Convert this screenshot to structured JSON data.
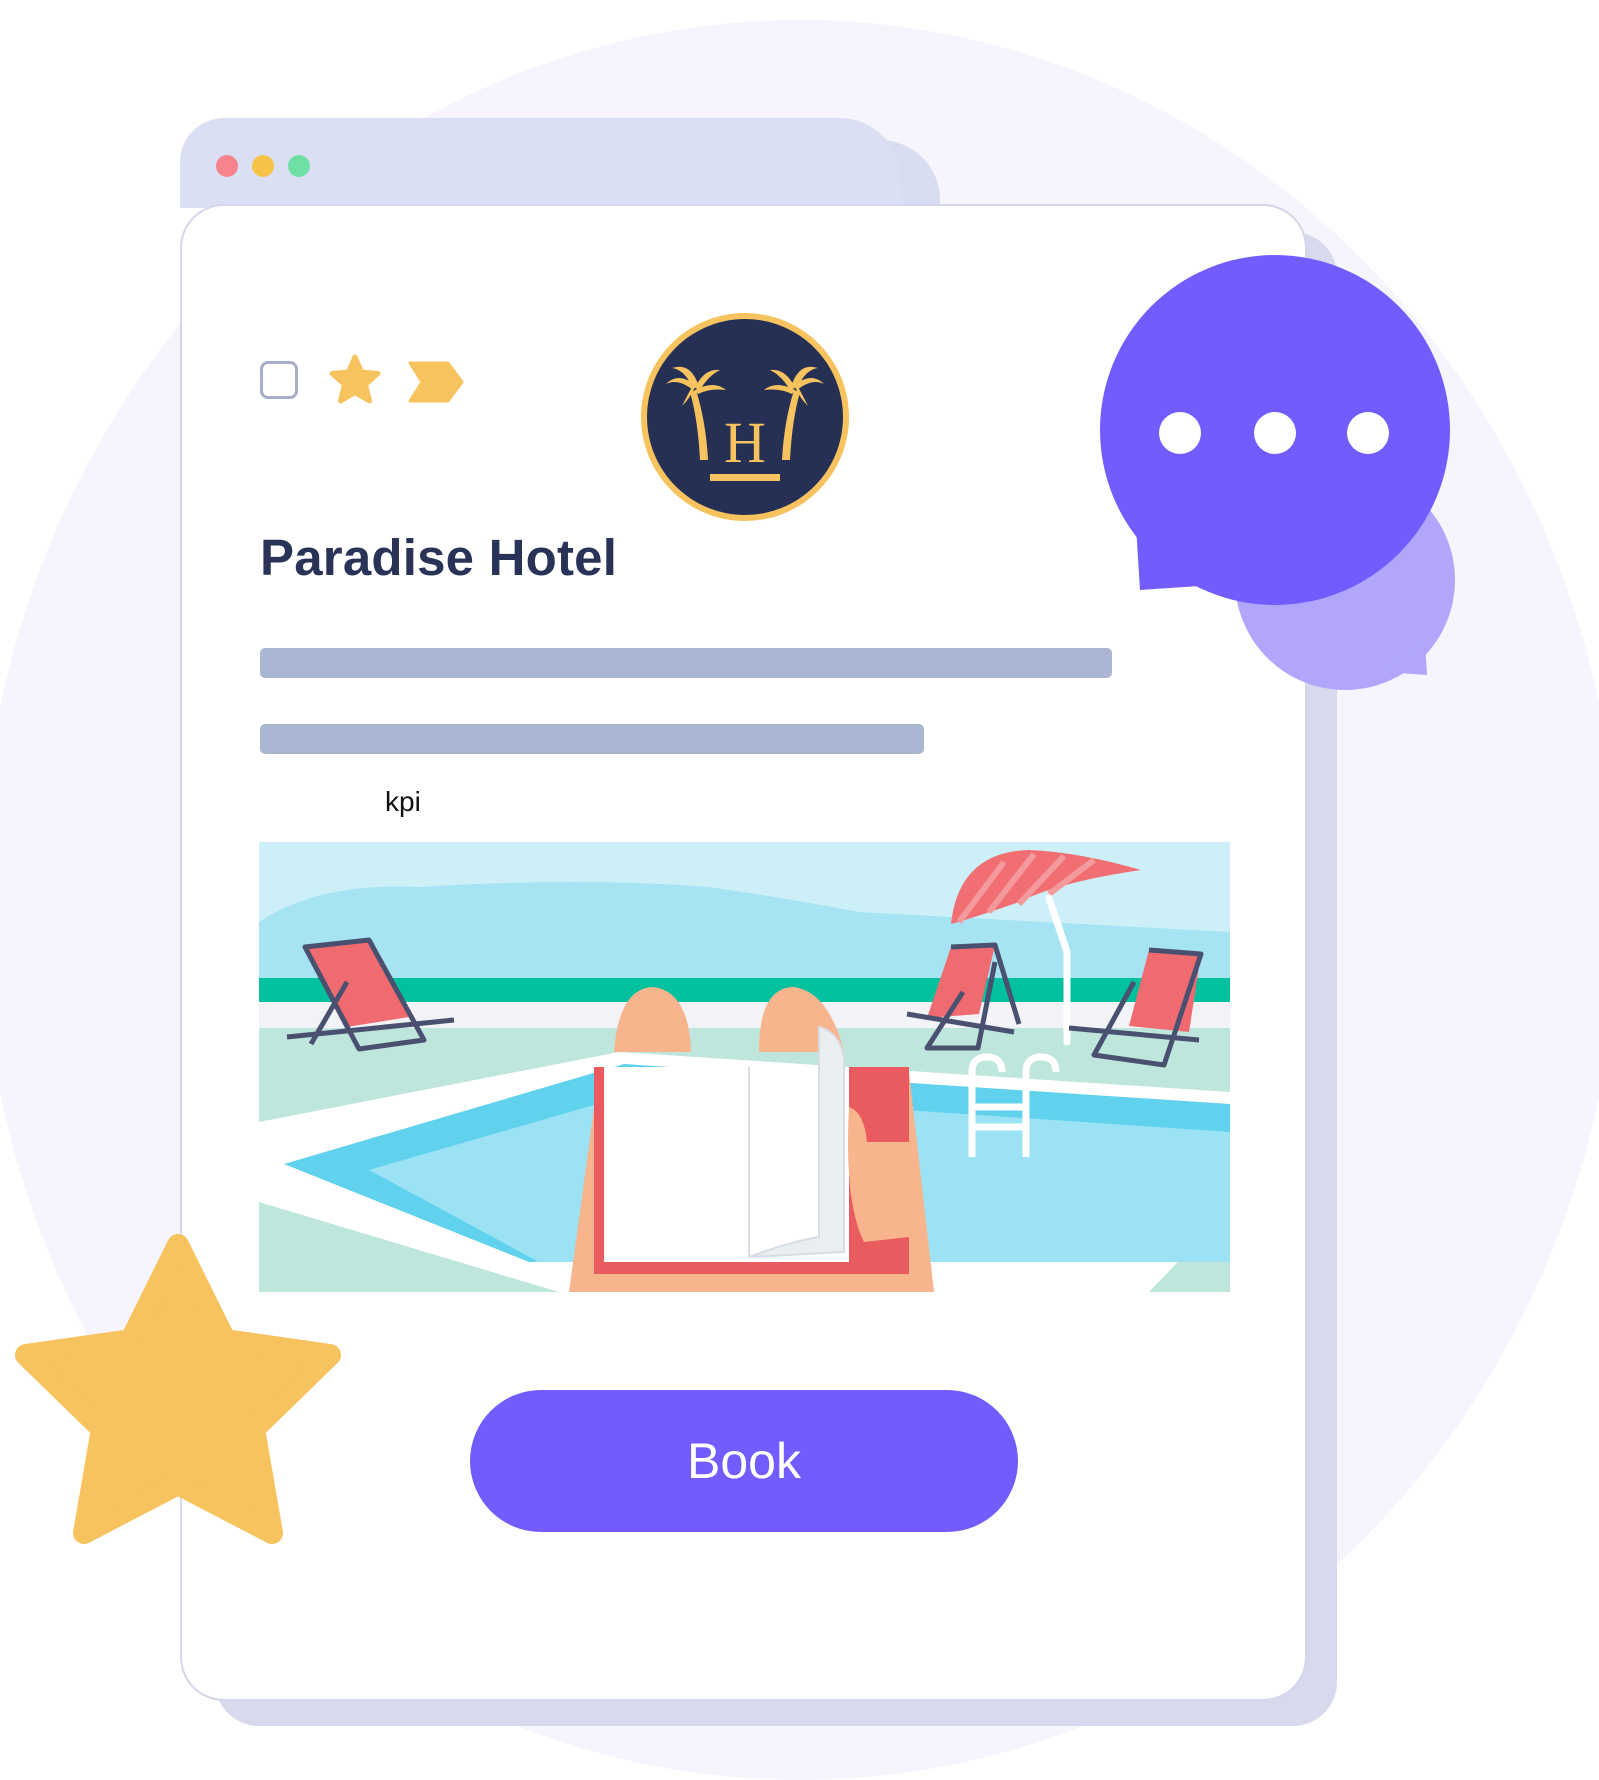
{
  "window": {
    "title_dots": [
      "close",
      "minimize",
      "maximize"
    ]
  },
  "hotel": {
    "name": "Paradise Hotel",
    "logo_letter": "H",
    "kpi_label": "kpi"
  },
  "actions": {
    "book_label": "Book"
  },
  "icons": {
    "checkbox": "checkbox-icon",
    "favorite": "star-icon",
    "tag": "tag-icon",
    "chat": "chat-bubble-icon",
    "decor_star": "star-icon"
  },
  "colors": {
    "accent": "#735cfd",
    "chat_secondary": "#b1a6fb",
    "star": "#f7c35f",
    "title": "#283357",
    "logo_bg": "#263055",
    "placeholder_bar": "#abb6d3"
  }
}
